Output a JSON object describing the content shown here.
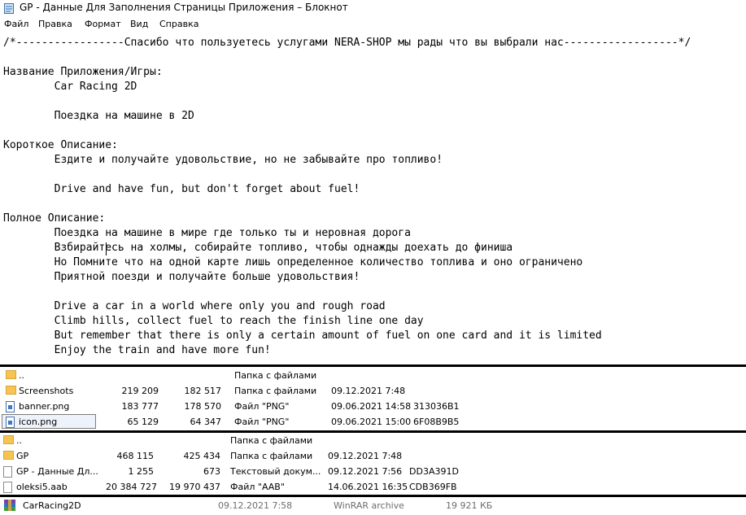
{
  "window": {
    "title": "GP - Данные Для Заполнения Страницы Приложения – Блокнот"
  },
  "menu": [
    "Файл",
    "Правка",
    "Формат",
    "Вид",
    "Справка"
  ],
  "editor": {
    "lines": [
      "/*-----------------Спасибо что пользуетесь услугами NERA-SHOP мы рады что вы выбрали нас------------------*/",
      "",
      "Название Приложения/Игры:",
      "        Car Racing 2D",
      "",
      "        Поездка на машине в 2D",
      "",
      "Короткое Описание:",
      "        Ездите и получайте удовольствие, но не забывайте про топливо!",
      "",
      "        Drive and have fun, but don't forget about fuel!",
      "",
      "Полное Описание:",
      "        Поездка на машине в мире где только ты и неровная дорога",
      "        Взбирайтесь на холмы, собирайте топливо, чтобы однажды доехать до финиша",
      "        Но Помните что на одной карте лишь определенное количество топлива и оно ограничено",
      "        Приятной поезди и получайте больше удовольствия!",
      "",
      "        Drive a car in a world where only you and rough road",
      "        Climb hills, collect fuel to reach the finish line one day",
      "        But remember that there is only a certain amount of fuel on one card and it is limited",
      "        Enjoy the train and have more fun!"
    ]
  },
  "panel1": {
    "rows": [
      {
        "name": "..",
        "size": "",
        "packed": "",
        "type": "Папка с файлами",
        "modified": "",
        "crc": "",
        "icon": "folder-icon"
      },
      {
        "name": "Screenshots",
        "size": "219 209",
        "packed": "182 517",
        "type": "Папка с файлами",
        "modified": "09.12.2021 7:48",
        "crc": "",
        "icon": "folder-icon"
      },
      {
        "name": "banner.png",
        "size": "183 777",
        "packed": "178 570",
        "type": "Файл \"PNG\"",
        "modified": "09.06.2021 14:58",
        "crc": "313036B1",
        "icon": "png-file-icon"
      },
      {
        "name": "icon.png",
        "size": "65 129",
        "packed": "64 347",
        "type": "Файл \"PNG\"",
        "modified": "09.06.2021 15:00",
        "crc": "6F08B9B5",
        "icon": "png-file-icon"
      }
    ]
  },
  "panel2": {
    "rows": [
      {
        "name": "..",
        "size": "",
        "packed": "",
        "type": "Папка с файлами",
        "modified": "",
        "crc": "",
        "icon": "folder-icon"
      },
      {
        "name": "GP",
        "size": "468 115",
        "packed": "425 434",
        "type": "Папка с файлами",
        "modified": "09.12.2021 7:48",
        "crc": "",
        "icon": "folder-icon"
      },
      {
        "name": "GP - Данные Дл...",
        "size": "1 255",
        "packed": "673",
        "type": "Текстовый докум...",
        "modified": "09.12.2021 7:56",
        "crc": "DD3A391D",
        "icon": "text-file-icon"
      },
      {
        "name": "oleksi5.aab",
        "size": "20 384 727",
        "packed": "19 970 437",
        "type": "Файл \"AAB\"",
        "modified": "14.06.2021 16:35",
        "crc": "CDB369FB",
        "icon": "file-icon"
      }
    ]
  },
  "archive": {
    "name": "CarRacing2D",
    "modified": "09.12.2021 7:58",
    "type": "WinRAR archive",
    "size": "19 921 КБ",
    "icon": "winrar-archive-icon"
  }
}
